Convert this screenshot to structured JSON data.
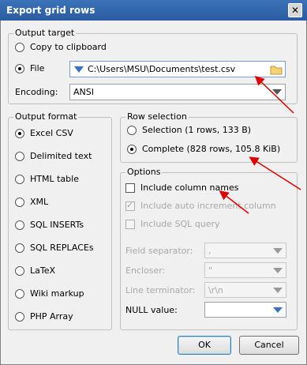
{
  "window": {
    "title": "Export grid rows",
    "close_glyph": "✕"
  },
  "output_target": {
    "legend": "Output target",
    "copy_label": "Copy to clipboard",
    "file_label": "File",
    "file_path": "C:\\Users\\MSU\\Documents\\test.csv",
    "encoding_label": "Encoding:",
    "encoding_value": "ANSI"
  },
  "output_format": {
    "legend": "Output format",
    "options": [
      "Excel CSV",
      "Delimited text",
      "HTML table",
      "XML",
      "SQL INSERTs",
      "SQL REPLACEs",
      "LaTeX",
      "Wiki markup",
      "PHP Array"
    ],
    "selected": "Excel CSV"
  },
  "row_selection": {
    "legend": "Row selection",
    "selection_label": "Selection (1 rows, 133 B)",
    "complete_label": "Complete (828 rows, 105.8 KiB)",
    "selected": "Complete (828 rows, 105.8 KiB)"
  },
  "options": {
    "legend": "Options",
    "include_column_names": "Include column names",
    "include_auto_increment": "Include auto increment column",
    "include_sql_query": "Include SQL query",
    "field_separator_label": "Field separator:",
    "field_separator_value": ",",
    "encloser_label": "Encloser:",
    "encloser_value": "\"",
    "line_terminator_label": "Line terminator:",
    "line_terminator_value": "\\r\\n",
    "null_value_label": "NULL value:",
    "null_value_value": ""
  },
  "buttons": {
    "ok": "OK",
    "cancel": "Cancel"
  },
  "colors": {
    "annotation_arrow": "#e00000",
    "titlebar": "#2a5ca0"
  }
}
